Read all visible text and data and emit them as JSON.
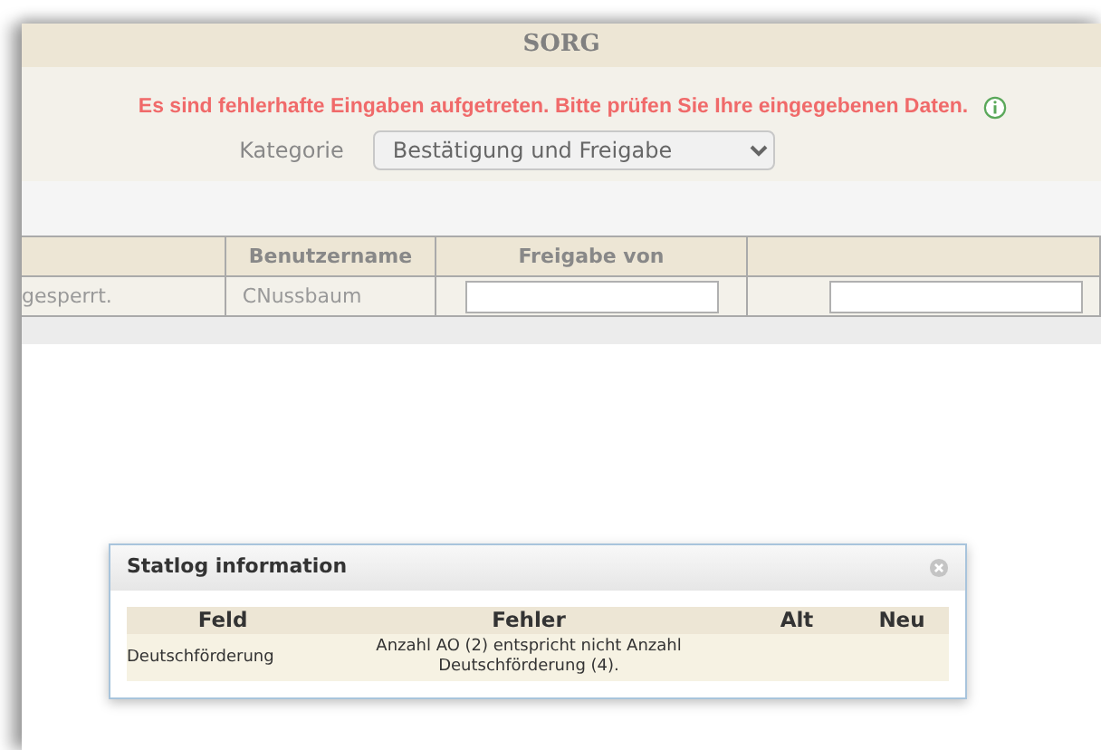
{
  "header": {
    "title": "SORG"
  },
  "error_message": "Es sind fehlerhafte Eingaben aufgetreten. Bitte prüfen Sie Ihre eingegebenen Daten.",
  "category": {
    "label": "Kategorie",
    "value": "Bestätigung und Freigabe"
  },
  "table": {
    "columns": [
      null,
      "Benutzername",
      "Freigabe von",
      null
    ],
    "rows": [
      {
        "cells": [
          {
            "kind": "text",
            "value": "gesperrt."
          },
          {
            "kind": "text",
            "value": "CNussbaum"
          },
          {
            "kind": "input"
          },
          {
            "kind": "input"
          }
        ]
      }
    ]
  },
  "dialog": {
    "title": "Statlog information",
    "columns": [
      "Feld",
      "Fehler",
      "Alt",
      "Neu"
    ],
    "rows": [
      {
        "feld": "Deutschförderung",
        "fehler": "Anzahl AO (2) entspricht nicht Anzahl Deutschförderung (4)."
      }
    ]
  }
}
